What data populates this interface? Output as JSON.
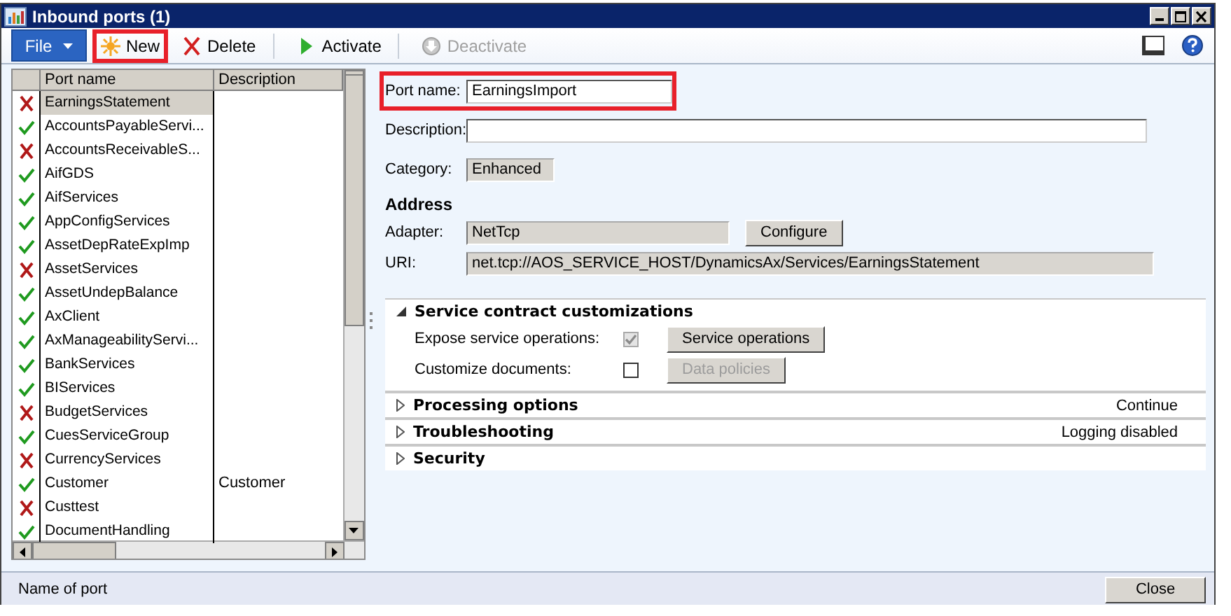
{
  "window": {
    "title": "Inbound ports (1)"
  },
  "toolbar": {
    "file_menu": "File",
    "buttons": [
      {
        "kind": "new",
        "label": "New",
        "disabled": false,
        "highlighted": true
      },
      {
        "kind": "delete",
        "label": "Delete",
        "disabled": false,
        "highlighted": false
      },
      {
        "kind": "activate",
        "label": "Activate",
        "disabled": false,
        "highlighted": false
      },
      {
        "kind": "deactivate",
        "label": "Deactivate",
        "disabled": true,
        "highlighted": false
      }
    ]
  },
  "grid": {
    "columns": [
      "Port name",
      "Description"
    ],
    "rows": [
      {
        "port_name": "EarningsStatement",
        "active": false,
        "selected": true
      },
      {
        "port_name": "AccountsPayableServi...",
        "active": true,
        "selected": false
      },
      {
        "port_name": "AccountsReceivableS...",
        "active": false,
        "selected": false
      },
      {
        "port_name": "AifGDS",
        "active": true,
        "selected": false
      },
      {
        "port_name": "AifServices",
        "active": true,
        "selected": false
      },
      {
        "port_name": "AppConfigServices",
        "active": true,
        "selected": false
      },
      {
        "port_name": "AssetDepRateExpImp",
        "active": true,
        "selected": false
      },
      {
        "port_name": "AssetServices",
        "active": false,
        "selected": false
      },
      {
        "port_name": "AssetUndepBalance",
        "active": true,
        "selected": false
      },
      {
        "port_name": "AxClient",
        "active": true,
        "selected": false
      },
      {
        "port_name": "AxManageabilityServi...",
        "active": true,
        "selected": false
      },
      {
        "port_name": "BankServices",
        "active": true,
        "selected": false
      },
      {
        "port_name": "BIServices",
        "active": true,
        "selected": false
      },
      {
        "port_name": "BudgetServices",
        "active": false,
        "selected": false
      },
      {
        "port_name": "CuesServiceGroup",
        "active": true,
        "selected": false
      },
      {
        "port_name": "CurrencyServices",
        "active": false,
        "selected": false
      },
      {
        "port_name": "Customer",
        "description": "Customer",
        "active": true,
        "selected": false
      },
      {
        "port_name": "Custtest",
        "active": false,
        "selected": false
      },
      {
        "port_name": "DocumentHandling",
        "active": true,
        "selected": false
      }
    ]
  },
  "form": {
    "fields": [
      {
        "label": "Port name:",
        "value": "EarningsImport",
        "editable": true,
        "highlighted": true
      },
      {
        "label": "Description:",
        "editable": true,
        "highlighted": false
      },
      {
        "label": "Category:",
        "value": "Enhanced",
        "editable": false,
        "highlighted": false
      }
    ],
    "address_heading": "Address",
    "address_fields": [
      {
        "label": "Adapter:",
        "value": "NetTcp",
        "editable": false,
        "button": "Configure"
      },
      {
        "label": "URI:",
        "value": "net.tcp://AOS_SERVICE_HOST/DynamicsAx/Services/EarningsStatement",
        "editable": false
      }
    ],
    "sections": [
      {
        "title": "Service contract customizations",
        "expanded": true,
        "options": [
          {
            "label": "Expose service operations:",
            "checked": true,
            "disabled": true,
            "button": "Service operations",
            "button_disabled": false
          },
          {
            "label": "Customize documents:",
            "checked": false,
            "disabled": false,
            "button": "Data policies",
            "button_disabled": true
          }
        ]
      },
      {
        "title": "Processing options",
        "expanded": false,
        "summary": "Continue"
      },
      {
        "title": "Troubleshooting",
        "expanded": false,
        "summary": "Logging disabled"
      },
      {
        "title": "Security",
        "expanded": false
      }
    ]
  },
  "status_bar": {
    "text": "Name of port",
    "close_button": "Close"
  }
}
